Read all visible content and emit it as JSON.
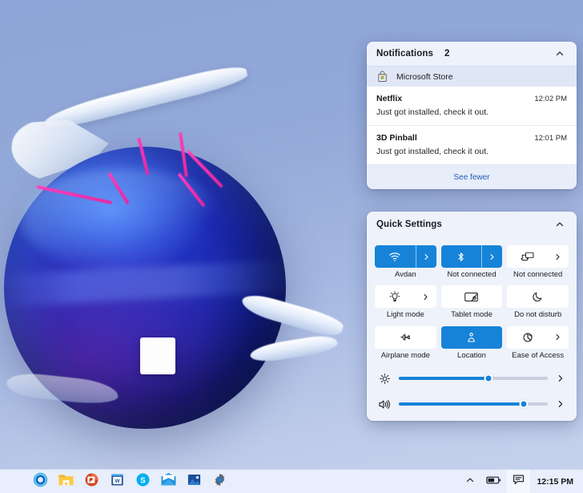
{
  "colors": {
    "accent": "#1683d8",
    "panel_bg": "#eef2fb",
    "notif_bg": "#ffffff",
    "taskbar_bg": "#e8eefb",
    "link": "#1f5fb5",
    "streak_pink": "#ff3cc0"
  },
  "notifications": {
    "title": "Notifications",
    "count": "2",
    "collapse_icon": "chevron-up-icon",
    "group": {
      "app_icon": "microsoft-store-icon",
      "name": "Microsoft Store"
    },
    "items": [
      {
        "app": "Netflix",
        "time": "12:02 PM",
        "body": "Just got installed, check it out."
      },
      {
        "app": "3D Pinball",
        "time": "12:01 PM",
        "body": "Just got installed, check it out."
      }
    ],
    "see_fewer": "See fewer"
  },
  "quick_settings": {
    "title": "Quick Settings",
    "collapse_icon": "chevron-up-icon",
    "tiles": [
      {
        "label": "Avdan",
        "icon": "wifi-icon",
        "on": true,
        "chevron": true
      },
      {
        "label": "Not connected",
        "icon": "bluetooth-icon",
        "on": true,
        "chevron": true
      },
      {
        "label": "Not connected",
        "icon": "cast-icon",
        "on": false,
        "chevron": true
      },
      {
        "label": "Light mode",
        "icon": "lightbulb-icon",
        "on": false,
        "chevron": true
      },
      {
        "label": "Tablet mode",
        "icon": "tablet-icon",
        "on": false,
        "chevron": false
      },
      {
        "label": "Do not disturb",
        "icon": "moon-icon",
        "on": false,
        "chevron": false
      },
      {
        "label": "Airplane mode",
        "icon": "airplane-icon",
        "on": false,
        "chevron": false
      },
      {
        "label": "Location",
        "icon": "location-pin-icon",
        "on": true,
        "chevron": false
      },
      {
        "label": "Ease of Access",
        "icon": "accessibility-icon",
        "on": false,
        "chevron": true
      }
    ],
    "sliders": [
      {
        "name": "brightness",
        "icon": "brightness-icon",
        "value": 60,
        "chevron": "chevron-right-icon"
      },
      {
        "name": "volume",
        "icon": "volume-icon",
        "value": 84,
        "chevron": "chevron-right-icon"
      }
    ]
  },
  "taskbar": {
    "apps": [
      {
        "name": "cortana-icon",
        "label": "Cortana"
      },
      {
        "name": "file-explorer-icon",
        "label": "File Explorer"
      },
      {
        "name": "powerpoint-icon",
        "label": "PowerPoint"
      },
      {
        "name": "word-icon",
        "label": "Word"
      },
      {
        "name": "skype-icon",
        "label": "Skype"
      },
      {
        "name": "mail-icon",
        "label": "Mail"
      },
      {
        "name": "photos-icon",
        "label": "Photos"
      },
      {
        "name": "settings-icon",
        "label": "Settings"
      }
    ],
    "tray": {
      "overflow_icon": "chevron-up-icon",
      "battery_icon": "battery-icon",
      "chat_icon": "chat-icon",
      "clock": "12:15 PM"
    }
  }
}
